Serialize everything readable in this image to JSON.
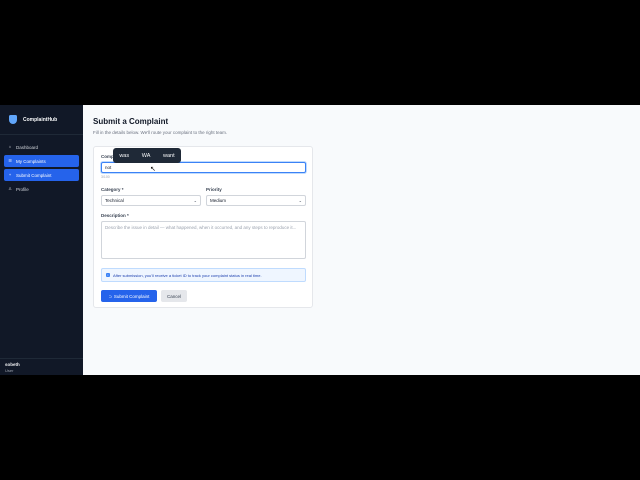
{
  "app": {
    "name": "ComplaintHub"
  },
  "sidebar": {
    "items": [
      {
        "label": "Dashboard",
        "icon": "home-icon"
      },
      {
        "label": "My Complaints",
        "icon": "list-icon"
      },
      {
        "label": "Submit Complaint",
        "icon": "plus-icon"
      },
      {
        "label": "Profile",
        "icon": "user-icon"
      }
    ],
    "user": {
      "name": "sobeth",
      "role": "User"
    }
  },
  "page": {
    "title": "Submit a Complaint",
    "subtitle": "Fill in the details below. We'll route your complaint to the right team."
  },
  "form": {
    "subject_label": "Compl",
    "subject_value": "not",
    "subject_counter": "3/100",
    "category_label": "Category *",
    "category_value": "Technical",
    "priority_label": "Priority",
    "priority_value": "Medium",
    "description_label": "Description *",
    "description_placeholder": "Describe the issue in detail — what happened, when it occurred, and any steps to reproduce it...",
    "info_text": "After submission, you'll receive a ticket ID to track your complaint status in real time.",
    "submit_label": "Submit Complaint",
    "cancel_label": "Cancel"
  },
  "autocomplete": {
    "suggestions": [
      "was",
      "WA",
      "want"
    ]
  },
  "colors": {
    "accent": "#2563eb",
    "sidebar": "#111827"
  }
}
